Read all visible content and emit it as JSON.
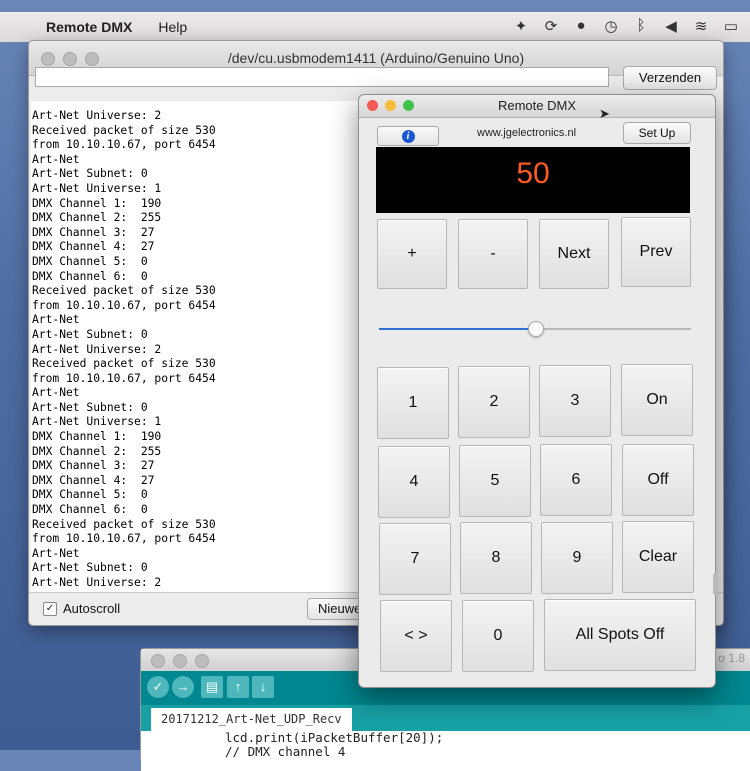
{
  "menubar": {
    "apple_icon": "apple-icon",
    "app_name": "Remote DMX",
    "help": "Help",
    "tray_icons": [
      "dropbox-icon",
      "sync-icon",
      "skype-icon",
      "time-machine-icon",
      "bluetooth-icon",
      "volume-icon",
      "wifi-icon",
      "battery-icon"
    ]
  },
  "serial_monitor": {
    "title": "/dev/cu.usbmodem1411 (Arduino/Genuino Uno)",
    "input_value": "",
    "send_label": "Verzenden",
    "output_lines": [
      "Art-Net Universe: 2",
      "Received packet of size 530",
      "from 10.10.10.67, port 6454",
      "Art-Net",
      "Art-Net Subnet: 0",
      "Art-Net Universe: 1",
      "DMX Channel 1:  190",
      "DMX Channel 2:  255",
      "DMX Channel 3:  27",
      "DMX Channel 4:  27",
      "DMX Channel 5:  0",
      "DMX Channel 6:  0",
      "Received packet of size 530",
      "from 10.10.10.67, port 6454",
      "Art-Net",
      "Art-Net Subnet: 0",
      "Art-Net Universe: 2",
      "Received packet of size 530",
      "from 10.10.10.67, port 6454",
      "Art-Net",
      "Art-Net Subnet: 0",
      "Art-Net Universe: 1",
      "DMX Channel 1:  190",
      "DMX Channel 2:  255",
      "DMX Channel 3:  27",
      "DMX Channel 4:  27",
      "DMX Channel 5:  0",
      "DMX Channel 6:  0",
      "Received packet of size 530",
      "from 10.10.10.67, port 6454",
      "Art-Net",
      "Art-Net Subnet: 0",
      "Art-Net Universe: 2"
    ],
    "autoscroll_label": "Autoscroll",
    "autoscroll_checked": "✓",
    "line_ending_label": "Nieuwe"
  },
  "ide": {
    "version": "o 1.8",
    "toolbar": [
      "verify-icon",
      "upload-icon",
      "new-icon",
      "open-icon",
      "save-icon"
    ],
    "tab": "20171212_Art-Net_UDP_Recv",
    "code_lines": [
      "lcd.print(iPacketBuffer[20]);",
      "// DMX channel 4"
    ]
  },
  "remote_dmx": {
    "title": "Remote DMX",
    "info_icon": "i",
    "website": "www.jgelectronics.nl",
    "setup_label": "Set Up",
    "display_value": "50",
    "slider_value": 0.5,
    "top_keys": [
      "+",
      "-",
      "Next",
      "Prev"
    ],
    "keypad": [
      [
        "1",
        "2",
        "3",
        "On"
      ],
      [
        "4",
        "5",
        "6",
        "Off"
      ],
      [
        "7",
        "8",
        "9",
        "Clear"
      ]
    ],
    "bottom_keys": {
      "arrows": "< >",
      "zero": "0",
      "all_off": "All Spots Off"
    },
    "colors": {
      "display_text": "#ff5a24",
      "slider": "#2f6fd6"
    }
  }
}
